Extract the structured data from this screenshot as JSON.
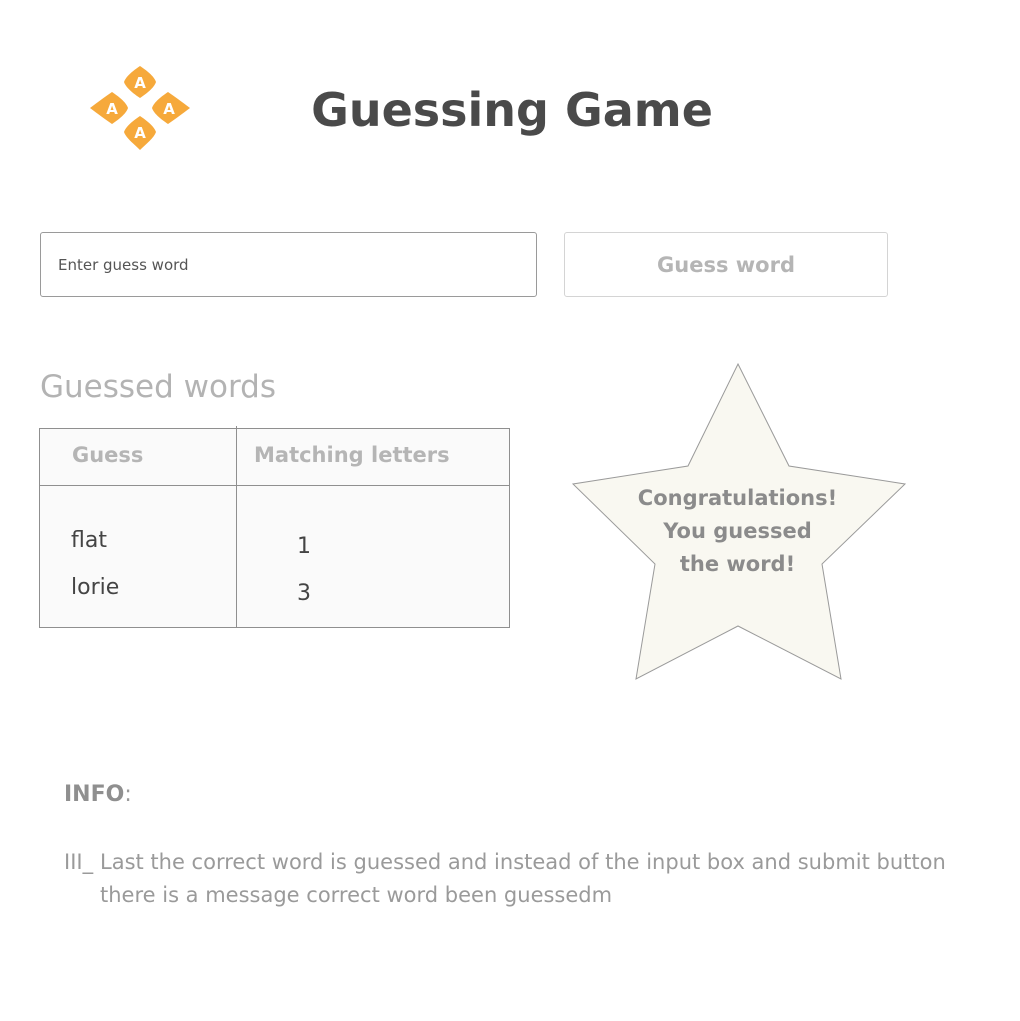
{
  "header": {
    "logo_letter": "A",
    "title": "Guessing Game"
  },
  "guess_form": {
    "input_placeholder": "Enter guess word",
    "input_value": "",
    "button_label": "Guess word"
  },
  "guessed_words": {
    "title": "Guessed words",
    "columns": [
      "Guess",
      "Matching letters"
    ],
    "rows": [
      {
        "guess": "flat",
        "matching": "1"
      },
      {
        "guess": "lorie",
        "matching": "3"
      }
    ]
  },
  "success_message": {
    "line1": "Congratulations!",
    "line2": "You guessed",
    "line3": "the word!"
  },
  "info": {
    "label": "INFO",
    "label_suffix": ":",
    "prefix": "III_",
    "text_line1": "Last  the correct word is guessed and instead of the input box and submit button",
    "text_line2": "there is a message  correct word been guessedm"
  },
  "colors": {
    "logo_orange": "#f6a93b",
    "star_fill": "#f9f8f1",
    "title_text": "#4a4a4a",
    "muted_text": "#b5b5b5"
  },
  "icons": {
    "logo": "four-diamond-letter-logo"
  }
}
